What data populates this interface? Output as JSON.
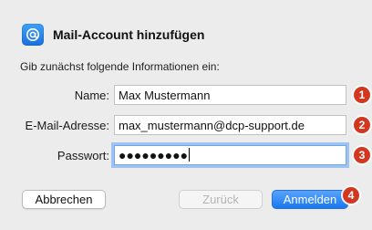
{
  "dialog": {
    "title": "Mail-Account hinzufügen",
    "intro": "Gib zunächst folgende Informationen ein:"
  },
  "form": {
    "name": {
      "label": "Name:",
      "value": "Max Mustermann",
      "badge": "1"
    },
    "email": {
      "label": "E-Mail-Adresse:",
      "value": "max_mustermann@dcp-support.de",
      "badge": "2"
    },
    "password": {
      "label": "Passwort:",
      "value": "●●●●●●●●●",
      "badge": "3"
    }
  },
  "buttons": {
    "cancel": "Abbrechen",
    "back": "Zurück",
    "create": "Anmelden",
    "create_badge": "4"
  },
  "icons": {
    "app": "mail-at-icon"
  },
  "colors": {
    "accent": "#1877f2",
    "badge": "#d2371f",
    "focus_ring": "#9ec3f1"
  }
}
